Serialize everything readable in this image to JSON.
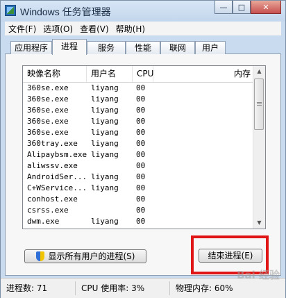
{
  "window": {
    "title": "Windows 任务管理器",
    "controls": {
      "minimize": "—",
      "maximize": "□",
      "close": "✕"
    }
  },
  "menu": [
    "文件(F)",
    "选项(O)",
    "查看(V)",
    "帮助(H)"
  ],
  "tabs": [
    "应用程序",
    "进程",
    "服务",
    "性能",
    "联网",
    "用户"
  ],
  "active_tab": "进程",
  "columns": [
    "映像名称",
    "用户名",
    "CPU",
    "内存"
  ],
  "processes": [
    {
      "name": "360se.exe",
      "user": "liyang",
      "cpu": "00"
    },
    {
      "name": "360se.exe",
      "user": "liyang",
      "cpu": "00"
    },
    {
      "name": "360se.exe",
      "user": "liyang",
      "cpu": "00"
    },
    {
      "name": "360se.exe",
      "user": "liyang",
      "cpu": "00"
    },
    {
      "name": "360se.exe",
      "user": "liyang",
      "cpu": "00"
    },
    {
      "name": "360tray.exe",
      "user": "liyang",
      "cpu": "00"
    },
    {
      "name": "Alipaybsm.exe",
      "user": "liyang",
      "cpu": "00"
    },
    {
      "name": "aliwssv.exe",
      "user": "",
      "cpu": "00"
    },
    {
      "name": "AndroidSer...",
      "user": "liyang",
      "cpu": "00"
    },
    {
      "name": "C+WService...",
      "user": "liyang",
      "cpu": "00"
    },
    {
      "name": "conhost.exe",
      "user": "",
      "cpu": "00"
    },
    {
      "name": "csrss.exe",
      "user": "",
      "cpu": "00"
    },
    {
      "name": "dwm.exe",
      "user": "liyang",
      "cpu": "00"
    }
  ],
  "buttons": {
    "show_all": "显示所有用户的进程(S)",
    "end_process": "结束进程(E)"
  },
  "status": {
    "processes": "进程数: 71",
    "cpu": "CPU 使用率: 3%",
    "memory": "物理内存: 60%"
  },
  "watermark": "Bai 经验",
  "colors": {
    "highlight": "#e01515"
  }
}
